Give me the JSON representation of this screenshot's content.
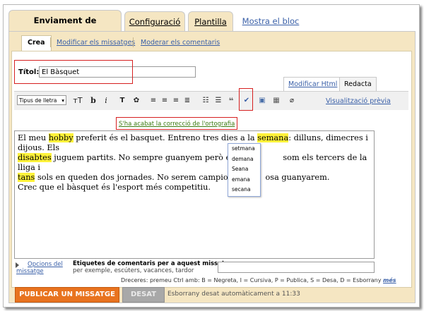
{
  "tabs": [
    {
      "label": "Enviament de missatges",
      "active": true
    },
    {
      "label": "Configuració"
    },
    {
      "label": "Plantilla"
    },
    {
      "label": "Mostra el  bloc"
    }
  ],
  "subtabs": [
    {
      "label": "Crea",
      "active": true
    },
    {
      "label": "Modificar els missatges"
    },
    {
      "label": "Moderar els comentaris"
    }
  ],
  "title_field": {
    "label": "Títol:",
    "value": "El Bàsquet"
  },
  "mode_tabs": {
    "html": "Modificar Html",
    "compose": "Redacta"
  },
  "toolbar": {
    "font_select": "Tipus de lletra",
    "size": "тT",
    "bold": "b",
    "italic": "i",
    "preview": "Visualització prèvia"
  },
  "spellcheck_message": "S'ha acabat la correcció de l'ortografia",
  "editor": {
    "l1a": "El meu ",
    "w1": "hobby",
    "l1b": " preferit és el basquet. Entreno tres dies a la ",
    "w2": "semana",
    "l1c": ": dilluns, dimecres i dijous. Els",
    "w3": "disabtes",
    "l2a": " juguem partits. No sempre guanyem però és ",
    "w4": "dibe",
    "l2b": "som els tercers de la lliga i",
    "w5": "tans",
    "l3a": " sols en queden dos jornades. No serem campions pero",
    "l3b": "osa guanyarem.",
    "l4": "Crec que el bàsquet és l'esport més competitiu."
  },
  "suggestions": [
    "setmana",
    "demana",
    "Seana",
    "emana",
    "secana"
  ],
  "options_link": "Opcions del missatge",
  "labels": {
    "title": "Etiquetes de comentaris per a aquest missatge:",
    "hint": "per exemple, escúters, vacances, tardor"
  },
  "shortcuts": {
    "text": "Dreceres: premeu Ctrl amb: B = Negreta, I = Cursiva, P = Publica, S = Desa, D = Esborrany",
    "more": "més"
  },
  "buttons": {
    "publish": "PUBLICAR UN MISSATGE",
    "save": "DESAT"
  },
  "autosave": "Esborrany desat automàticament a 11:33"
}
